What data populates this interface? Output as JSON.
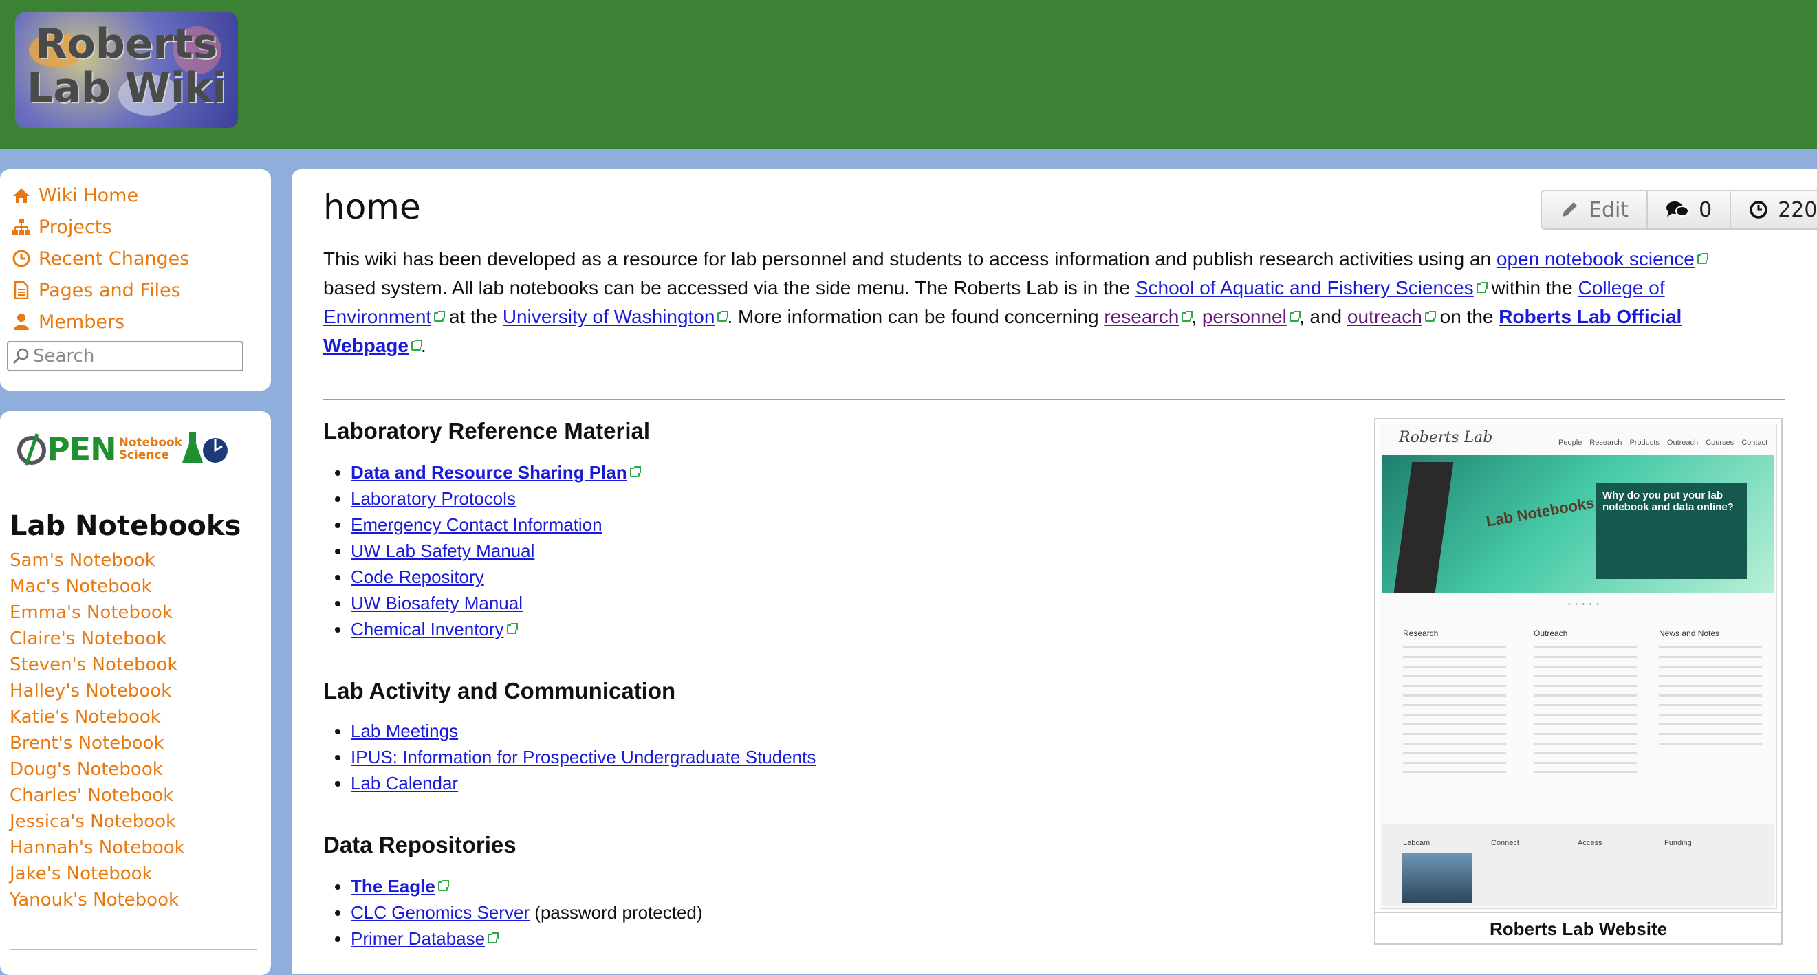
{
  "header": {
    "logo_text": "Roberts\nLab Wiki"
  },
  "nav": {
    "items": [
      {
        "label": "Wiki Home",
        "icon": "home-icon"
      },
      {
        "label": "Projects",
        "icon": "sitemap-icon"
      },
      {
        "label": "Recent Changes",
        "icon": "clock-icon"
      },
      {
        "label": "Pages and Files",
        "icon": "file-icon"
      },
      {
        "label": "Members",
        "icon": "user-icon"
      }
    ],
    "search_placeholder": "Search"
  },
  "ons_logo": {
    "word": "PEN",
    "small1": "Notebook",
    "small2": "Science"
  },
  "notebooks": {
    "title": "Lab Notebooks",
    "items": [
      "Sam's Notebook",
      "Mac's Notebook",
      "Emma's Notebook",
      "Claire's Notebook",
      "Steven's Notebook",
      "Halley's Notebook",
      "Katie's Notebook",
      "Brent's Notebook",
      "Doug's Notebook",
      "Charles' Notebook",
      "Jessica's Notebook",
      "Hannah's Notebook",
      "Jake's Notebook",
      "Yanouk's Notebook"
    ]
  },
  "page": {
    "title": "home",
    "toolbar": {
      "edit": "Edit",
      "comments": "0",
      "history": "220"
    },
    "intro": {
      "t1": "This wiki has been developed as a resource for lab personnel and students to access information and publish research activities using an ",
      "l1": "open notebook science",
      "t2": " based system. All lab notebooks can be accessed via the side menu. The Roberts Lab is in the ",
      "l2": "School of Aquatic and Fishery Sciences",
      "t3": " within the ",
      "l3": "College of Environment",
      "t4": " at the ",
      "l4": "University of Washington",
      "t5": ". More information can be found concerning ",
      "l5": "research",
      "t6": ", ",
      "l6": "personnel",
      "t7": ", and ",
      "l7": "outreach",
      "t8": " on the ",
      "l8": "Roberts Lab Official Webpage",
      "t9": "."
    },
    "sections": [
      {
        "heading": "Laboratory Reference Material",
        "links": [
          "Data and Resource Sharing Plan",
          "Laboratory Protocols",
          "Emergency Contact Information",
          "UW Lab Safety Manual",
          "Code Repository",
          "UW Biosafety Manual",
          "Chemical Inventory"
        ]
      },
      {
        "heading": "Lab Activity and Communication",
        "links": [
          "Lab Meetings",
          "IPUS: Information for Prospective Undergraduate Students",
          "Lab Calendar"
        ]
      },
      {
        "heading": "Data Repositories",
        "links": [
          "The Eagle",
          "CLC Genomics Server",
          "Primer Database"
        ],
        "note": " (password protected)"
      }
    ],
    "website": {
      "caption": "Roberts Lab Website",
      "site_title": "Roberts Lab",
      "site_nav": "People Research Products Outreach Courses Contact",
      "hero_notebooks": "Lab Notebooks",
      "hero_popup": "Why do you put your lab notebook and data online?",
      "cols": [
        "Research",
        "Outreach",
        "News and Notes"
      ],
      "foot": [
        "Labcam",
        "Connect",
        "Access",
        "Funding"
      ]
    }
  }
}
